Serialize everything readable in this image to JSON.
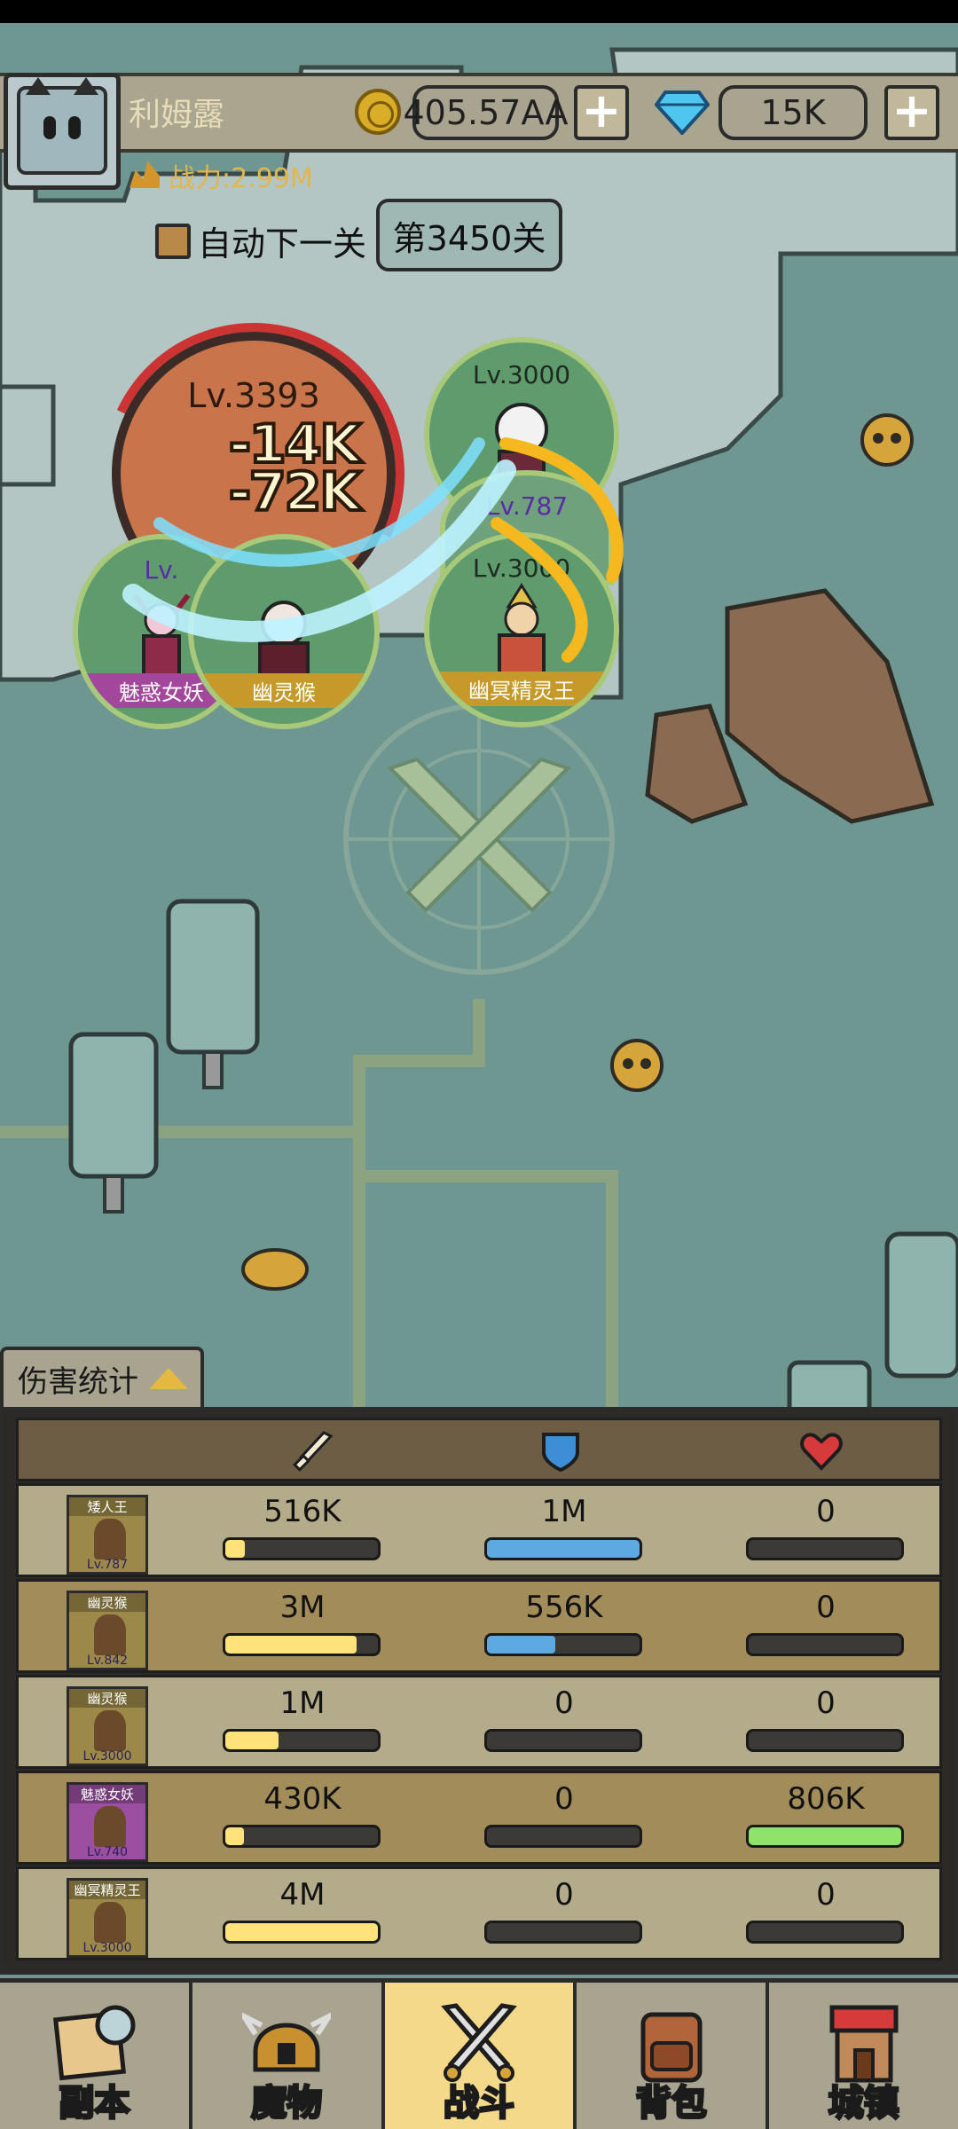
{
  "player": {
    "name": "利姆露",
    "power": "战力:2.99M",
    "gold": "405.57AA",
    "gems": "15K",
    "add_symbol": "+"
  },
  "stage": {
    "auto_next_label": "自动下一关",
    "auto_next_checked": false,
    "stage_label": "第3450关"
  },
  "battle": {
    "boss_level": "Lv.3393",
    "boss_hp_fraction": 0.15,
    "damage_popups": [
      "-14K",
      "-72K"
    ],
    "units": [
      {
        "level": "Lv.3000",
        "name": ""
      },
      {
        "level": "Lv.787",
        "name": ""
      },
      {
        "level": "Lv.3000",
        "name": "幽冥精灵王"
      },
      {
        "level": "Lv.",
        "name": "魅惑女妖"
      },
      {
        "level": "",
        "name": "幽灵猴"
      }
    ]
  },
  "damage_stats": {
    "tab_label": "伤害统计",
    "columns": [
      "attack-sword",
      "defense-shield",
      "heal-heart"
    ],
    "rows": [
      {
        "name": "矮人王",
        "level": "Lv.787",
        "attack": "516K",
        "attack_frac": 0.13,
        "defense": "1M",
        "defense_frac": 1.0,
        "heal": "0",
        "heal_frac": 0
      },
      {
        "name": "幽灵猴",
        "level": "Lv.842",
        "attack": "3M",
        "attack_frac": 0.86,
        "defense": "556K",
        "defense_frac": 0.45,
        "heal": "0",
        "heal_frac": 0
      },
      {
        "name": "幽灵猴",
        "level": "Lv.3000",
        "attack": "1M",
        "attack_frac": 0.35,
        "defense": "0",
        "defense_frac": 0,
        "heal": "0",
        "heal_frac": 0
      },
      {
        "name": "魅惑女妖",
        "level": "Lv.740",
        "attack": "430K",
        "attack_frac": 0.12,
        "defense": "0",
        "defense_frac": 0,
        "heal": "806K",
        "heal_frac": 1.0
      },
      {
        "name": "幽冥精灵王",
        "level": "Lv.3000",
        "attack": "4M",
        "attack_frac": 1.0,
        "defense": "0",
        "defense_frac": 0,
        "heal": "0",
        "heal_frac": 0
      }
    ]
  },
  "nav": {
    "items": [
      {
        "label": "副本",
        "icon": "map-compass-icon",
        "active": false
      },
      {
        "label": "魔物",
        "icon": "monster-helmet-icon",
        "active": false
      },
      {
        "label": "战斗",
        "icon": "crossed-swords-icon",
        "active": true
      },
      {
        "label": "背包",
        "icon": "backpack-icon",
        "active": false
      },
      {
        "label": "城镇",
        "icon": "shop-building-icon",
        "active": false
      }
    ]
  },
  "colors": {
    "map_bg": "#6f9792",
    "attack_bar": "#ffe37a",
    "defense_bar": "#5ea9df",
    "heal_bar": "#8fe36a",
    "active_tab": "#f5d98a"
  }
}
